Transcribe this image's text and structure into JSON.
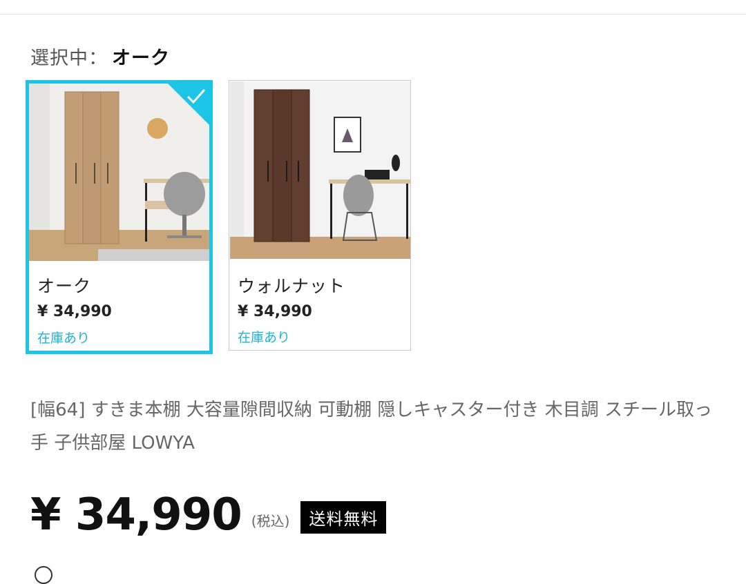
{
  "selection": {
    "label": "選択中：",
    "value": "オーク"
  },
  "variants": [
    {
      "name": "オーク",
      "price": "¥ 34,990",
      "stock": "在庫あり",
      "selected": true
    },
    {
      "name": "ウォルナット",
      "price": "¥ 34,990",
      "stock": "在庫あり",
      "selected": false
    }
  ],
  "product": {
    "title": "[幅64] すきま本棚 大容量隙間収納 可動棚 隠しキャスター付き 木目調 スチール取っ手 子供部屋  LOWYA",
    "price": "¥ 34,990",
    "tax_note": "(税込)",
    "shipping_badge": "送料無料"
  },
  "colors": {
    "accent": "#1cc4e6",
    "stock_text": "#1cb4d8"
  }
}
